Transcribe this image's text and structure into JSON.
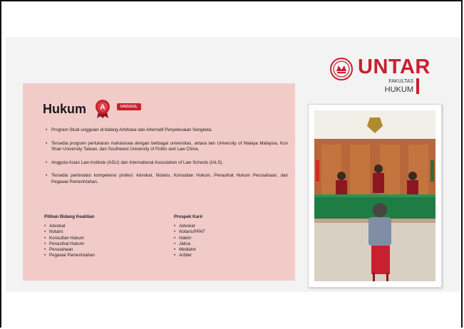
{
  "logo": {
    "wordmark": "UNTAR",
    "faculty_line1": "FAKULTAS",
    "faculty_line2": "HUKUM"
  },
  "card": {
    "title": "Hukum",
    "badge": "UNGGUL",
    "bullets": [
      "Program Studi unggulan di bidang Arbitrase dan Alternatif Penyelesaian Sengketa.",
      "Tersedia program pertukaran mahasiswa dengan berbagai universitas, antara lain University of Malaya Malaysia, Kun Shan University Taiwan, dan Southwest University of Politic and Law China.",
      "Anggota Asian Law Institute (ASLI) dan International Association of Law Schools (IALS).",
      "Tersedia peminatan kompetensi profesi: Advokat, Notaris, Konsultan Hukum, Penasihat Hukum Perusahaan, dan Pegawai Pemerintahan."
    ],
    "keahlian": {
      "heading": "Pilihan Bidang Keahlian",
      "items": [
        "Advokat",
        "Notaris",
        "Konsultan Hukum",
        "Penasihat Hukum",
        "Perusahaan",
        "Pegawai Pemerintahan"
      ]
    },
    "karir": {
      "heading": "Prospek Karir",
      "items": [
        "Advokat",
        "Notaris/PPAT",
        "Hakim",
        "Jaksa",
        "Mediator",
        "Arbiter"
      ]
    }
  },
  "colors": {
    "brand_red": "#c8202f",
    "card_pink": "#f1cbc8"
  }
}
